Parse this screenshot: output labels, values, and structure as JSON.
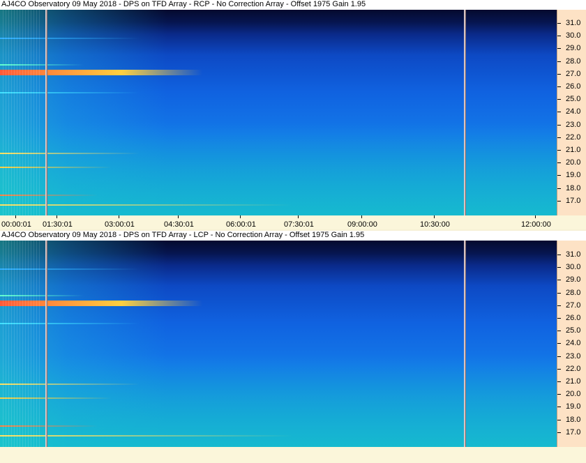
{
  "panels": [
    {
      "title": "AJ4CO Observatory 09 May 2018 - DPS on TFD Array  - RCP  -  No Correction Array  -  Offset 1975  Gain 1.95",
      "polarization": "RCP"
    },
    {
      "title": "AJ4CO Observatory 09 May 2018 - DPS on TFD Array  - LCP  -  No Correction Array  -  Offset 1975  Gain 1.95",
      "polarization": "LCP"
    }
  ],
  "y_axis": {
    "labels": [
      "31.0",
      "30.0",
      "29.0",
      "28.0",
      "27.0",
      "26.0",
      "25.0",
      "24.0",
      "23.0",
      "22.0",
      "21.0",
      "20.0",
      "19.0",
      "18.0",
      "17.0"
    ]
  },
  "x_axis": {
    "labels": [
      "00:00:01",
      "01:30:01",
      "03:00:01",
      "04:30:01",
      "06:00:01",
      "07:30:01",
      "09:00:00",
      "10:30:00",
      "12:00:00"
    ]
  },
  "colors": {
    "background": "#f7f1d6",
    "axis_panel": "#fde2c5",
    "plot_top": "#050a2e",
    "plot_bottom": "#18a8d8",
    "hot_band": "#ff6a3d"
  }
}
